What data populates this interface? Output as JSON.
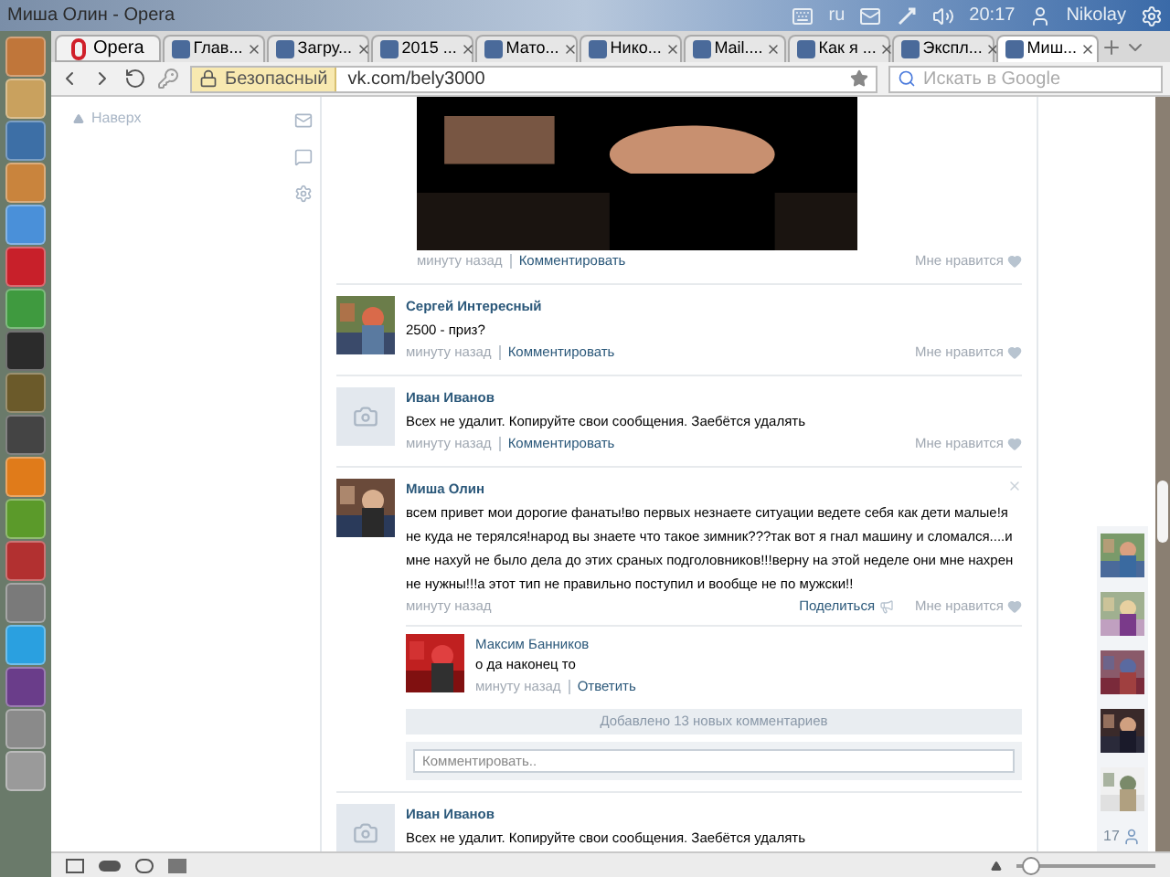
{
  "top_panel": {
    "window_title": "Миша Олин - Opera",
    "keyboard_layout": "ru",
    "time": "20:17",
    "user": "Nikolay"
  },
  "menu_button": "Opera",
  "tabs": [
    {
      "label": "Глав...",
      "selected": false
    },
    {
      "label": "Загру...",
      "selected": false
    },
    {
      "label": "2015 ...",
      "selected": false
    },
    {
      "label": "Мато...",
      "selected": false
    },
    {
      "label": "Нико...",
      "selected": false
    },
    {
      "label": "Mail....",
      "selected": false
    },
    {
      "label": "Как я ...",
      "selected": false
    },
    {
      "label": "Экспл...",
      "selected": false
    },
    {
      "label": "Миш...",
      "selected": true
    }
  ],
  "address_bar": {
    "security": "Безопасный",
    "url": "vk.com/bely3000",
    "search_placeholder": "Искать в Google"
  },
  "left_column": {
    "to_top": "Наверх"
  },
  "post_footer": {
    "time": "минуту назад",
    "comment": "Комментировать",
    "like": "Мне нравится"
  },
  "comments": [
    {
      "author": "Сергей Интересный",
      "text": "2500 - приз?",
      "time": "минуту назад",
      "comment": "Комментировать",
      "like": "Мне нравится"
    },
    {
      "kind": "camera",
      "author": "Иван Иванов",
      "text": "Всех не удалит. Копируйте свои сообщения. Заебётся удалять",
      "time": "минуту назад",
      "comment": "Комментировать",
      "like": "Мне нравится"
    },
    {
      "author": "Миша Олин",
      "text": "всем привет мои дорогие фанаты!во первых незнаете ситуации ведете себя как дети малые!я не куда не терялся!народ вы знаете что такое зимник???так вот я гнал машину и сломался....и мне нахуй не было дела до этих сраных подголовников!!!верну на этой неделе они мне нахрен не нужны!!!а этот тип не правильно поступил и вообще не по мужски!!",
      "time": "минуту назад",
      "share": "Поделиться",
      "like": "Мне нравится",
      "replies": [
        {
          "author": "Максим Банников",
          "text": "о да наконец то",
          "time": "минуту назад",
          "reply": "Ответить"
        }
      ],
      "new_comments": "Добавлено 13 новых комментариев",
      "comment_placeholder": "Комментировать.."
    },
    {
      "kind": "camera",
      "author": "Иван Иванов",
      "text": "Всех не удалит. Копируйте свои сообщения. Заебётся удалять"
    }
  ],
  "friends": {
    "count": "17"
  },
  "zoom_slider": {
    "level": 0.1
  }
}
